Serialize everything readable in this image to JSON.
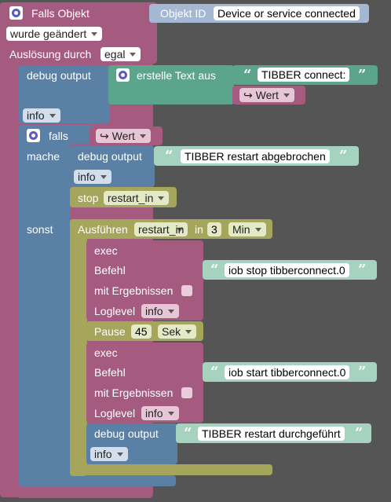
{
  "event": {
    "title": "Falls Objekt",
    "object_id_label": "Objekt ID",
    "object_id_value": "Device or service connected",
    "trigger_mode": "wurde geändert",
    "trigger_by_label": "Auslösung durch",
    "trigger_by_value": "egal"
  },
  "debug1": {
    "label": "debug output",
    "text_label": "erstelle Text aus",
    "text_part1": "TIBBER connect:",
    "value_ref": "Wert",
    "level": "info"
  },
  "if_block": {
    "if_label": "falls",
    "condition": "Wert",
    "do_label": "mache",
    "else_label": "sonst"
  },
  "debug2": {
    "label": "debug output",
    "text": "TIBBER restart abgebrochen",
    "level": "info"
  },
  "stop": {
    "label": "stop",
    "timer": "restart_in"
  },
  "timeout": {
    "label": "Ausführen",
    "timer": "restart_in",
    "in_label": "in",
    "amount": "3",
    "unit": "Min"
  },
  "exec1": {
    "label": "exec",
    "cmd_label": "Befehl",
    "cmd": "iob stop tibberconnect.0",
    "results_label": "mit Ergebnissen",
    "log_label": "Loglevel",
    "log_value": "info"
  },
  "pause": {
    "label": "Pause",
    "amount": "45",
    "unit": "Sek"
  },
  "exec2": {
    "label": "exec",
    "cmd_label": "Befehl",
    "cmd": "iob start tibberconnect.0",
    "results_label": "mit Ergebnissen",
    "log_label": "Loglevel",
    "log_value": "info"
  },
  "debug3": {
    "label": "debug output",
    "text": "TIBBER restart durchgeführt",
    "level": "info"
  },
  "colors": {
    "event": "#a55b80",
    "logic": "#5b80a5",
    "debug_text": "#5ba58c",
    "timer": "#a5a55b",
    "text": "#a5d3c0",
    "object": "#a5b8d3"
  }
}
